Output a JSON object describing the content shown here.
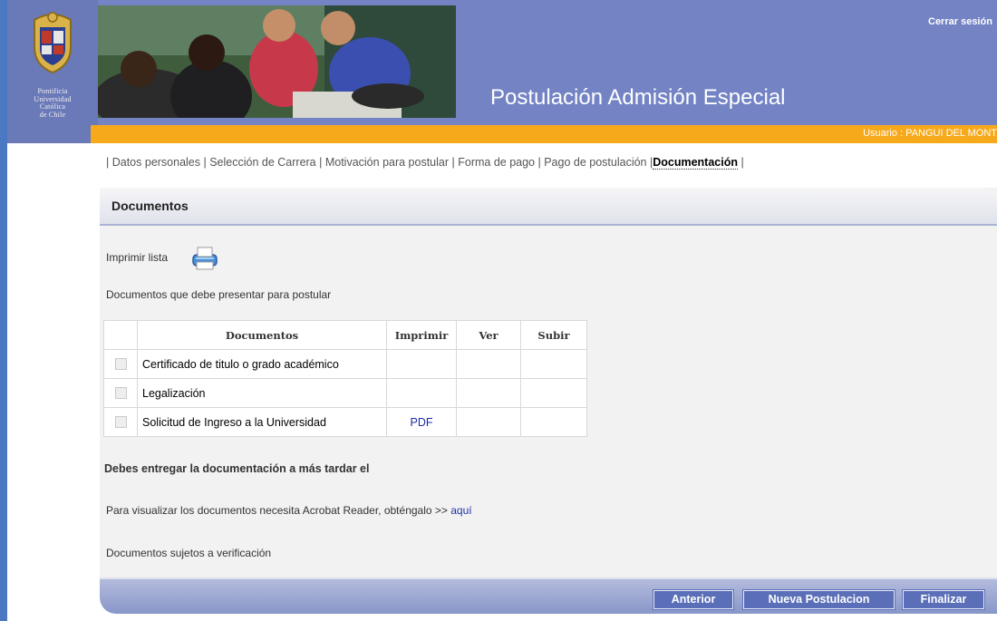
{
  "header": {
    "university_lines": [
      "Pontificia",
      "Universidad",
      "Católica",
      "de Chile"
    ],
    "app_title": "Postulación Admisión Especial",
    "logout_label": "Cerrar sesión",
    "user_text": "Usuario : PANGUI DEL MONT"
  },
  "nav": {
    "items": [
      {
        "label": "Datos personales"
      },
      {
        "label": "Selección de Carrera"
      },
      {
        "label": "Motivación para postular"
      },
      {
        "label": "Forma de pago"
      },
      {
        "label": "Pago de postulación"
      },
      {
        "label": "Documentación",
        "active": true
      }
    ]
  },
  "panel": {
    "title": "Documentos",
    "print_label": "Imprimir lista",
    "description": "Documentos que debe presentar para postular",
    "table": {
      "headers": [
        "Documentos",
        "Imprimir",
        "Ver",
        "Subir"
      ],
      "rows": [
        {
          "document": "Certificado de titulo o grado académico",
          "print": "",
          "view": "",
          "upload": ""
        },
        {
          "document": "Legalización",
          "print": "",
          "view": "",
          "upload": ""
        },
        {
          "document": "Solicitud de Ingreso a la Universidad",
          "print": "PDF",
          "view": "",
          "upload": ""
        }
      ]
    },
    "deadline_text": "Debes entregar la documentación a más tardar el",
    "acrobat_text": "Para visualizar los documentos necesita Acrobat Reader, obténgalo >>",
    "acrobat_link": "aquí",
    "verification_text": "Documentos sujetos a verificación"
  },
  "buttons": {
    "previous": "Anterior",
    "new_application": "Nueva Postulacion",
    "finish": "Finalizar"
  },
  "colors": {
    "header_bg": "#7383c4",
    "user_bar": "#f7a91c",
    "button_bg": "#5b6fb8",
    "link": "#1f2ba8"
  }
}
